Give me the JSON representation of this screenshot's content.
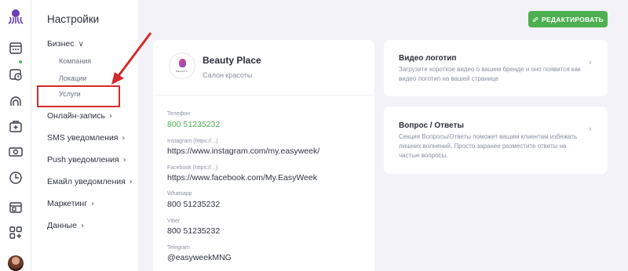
{
  "rail": {
    "icons": [
      "octopus-logo-icon",
      "calendar-icon",
      "calendar-clock-icon",
      "clients-icon",
      "services-icon",
      "payments-icon",
      "clock-icon",
      "widget-icon",
      "apps-icon"
    ]
  },
  "settings": {
    "title": "Настройки",
    "business": {
      "label": "Бизнес",
      "chevron": "∨"
    },
    "sub_items": {
      "company": "Компания",
      "locations": "Локации",
      "services": "Услуги"
    },
    "items": [
      {
        "label": "Онлайн-запись",
        "chevron": "›"
      },
      {
        "label": "SMS уведомления",
        "chevron": "›"
      },
      {
        "label": "Push уведомления",
        "chevron": "›"
      },
      {
        "label": "Емайл уведомления",
        "chevron": "›"
      },
      {
        "label": "Маркетинг",
        "chevron": "›"
      },
      {
        "label": "Данные",
        "chevron": "›"
      }
    ]
  },
  "toolbar": {
    "edit_label": "РЕДАКТИРОВАТЬ"
  },
  "business": {
    "logo_text": "BEAUTY",
    "name": "Beauty Place",
    "type": "Салон красоты",
    "fields": [
      {
        "label": "Телефон",
        "value": "800 51235232"
      },
      {
        "label": "Instagram (https://...)",
        "value": "https://www.instagram.com/my.easyweek/"
      },
      {
        "label": "Facebook (https://...)",
        "value": "https://www.facebook.com/My.EasyWeek"
      },
      {
        "label": "Whatsapp",
        "value": "800 51235232"
      },
      {
        "label": "Viber",
        "value": "800 51235232"
      },
      {
        "label": "Telegram",
        "value": "@easyweekMNG"
      }
    ]
  },
  "cards": {
    "video": {
      "title": "Видео логотип",
      "desc": "Загрузите короткое видео о вашем бренде и оно появится как видео логотип на вашей странице",
      "chevron": "›"
    },
    "faq": {
      "title": "Вопрос / Ответы",
      "desc": "Секция Вопросы/Ответы поможет вашим клиентам избежать лишних волнений. Просто заранее разместите ответы на частые вопросы.",
      "chevron": "›"
    }
  },
  "colors": {
    "accent": "#4caf50",
    "highlight": "#d42a2a",
    "background": "#f2f2f8"
  }
}
